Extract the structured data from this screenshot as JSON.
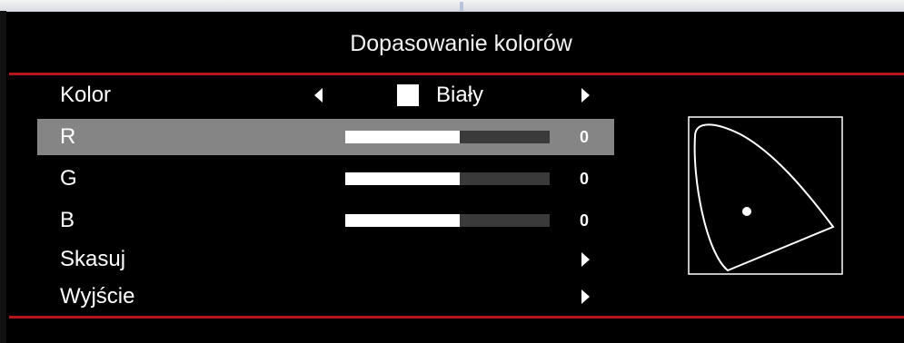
{
  "title": "Dopasowanie kolorów",
  "menu": {
    "kolor": {
      "label": "Kolor",
      "value": "Biały",
      "swatch_color": "#ffffff"
    },
    "r": {
      "label": "R",
      "value": "0",
      "bar_fraction": 0.56
    },
    "g": {
      "label": "G",
      "value": "0",
      "bar_fraction": 0.56
    },
    "b": {
      "label": "B",
      "value": "0",
      "bar_fraction": 0.56
    },
    "skasuj": {
      "label": "Skasuj"
    },
    "wyjscie": {
      "label": "Wyjście"
    }
  },
  "colors": {
    "background": "#000000",
    "accent_rule": "#b4161b",
    "selected_row": "#858585",
    "bar_track": "#3a3a3a",
    "bar_fill": "#ffffff"
  }
}
